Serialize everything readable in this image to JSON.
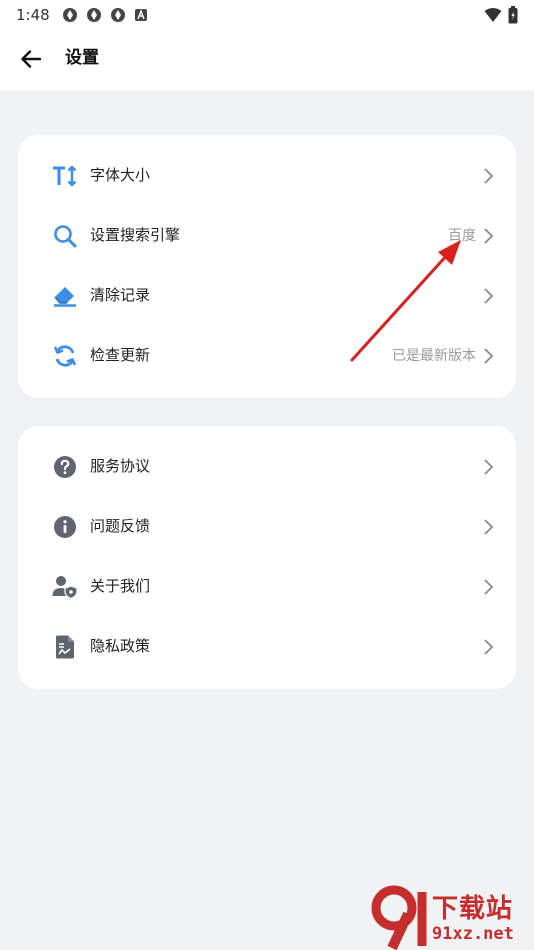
{
  "status_bar": {
    "time": "1:48"
  },
  "header": {
    "title": "设置"
  },
  "group1": [
    {
      "label": "字体大小",
      "value": "",
      "icon": "font-size-icon"
    },
    {
      "label": "设置搜索引擎",
      "value": "百度",
      "icon": "search-icon"
    },
    {
      "label": "清除记录",
      "value": "",
      "icon": "eraser-icon"
    },
    {
      "label": "检查更新",
      "value": "已是最新版本",
      "icon": "refresh-icon"
    }
  ],
  "group2": [
    {
      "label": "服务协议",
      "icon": "question-icon"
    },
    {
      "label": "问题反馈",
      "icon": "info-icon"
    },
    {
      "label": "关于我们",
      "icon": "user-shield-icon"
    },
    {
      "label": "隐私政策",
      "icon": "document-icon"
    }
  ],
  "watermark": {
    "brand": "下载站",
    "url": "91xz.net"
  },
  "colors": {
    "accent_blue": "#3a8ee6",
    "gray_icon": "#5f6470",
    "annotation_red": "#d9201f",
    "watermark_red": "#c62d2d"
  }
}
